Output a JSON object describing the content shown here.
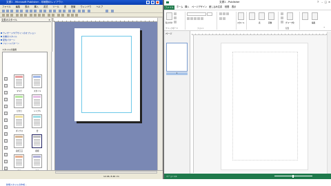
{
  "left_app": {
    "title": "文書1 - Microsoft Publisher - 印刷物のレイアウト",
    "menu": [
      "ファイル",
      "編集",
      "表示",
      "挿入",
      "書式",
      "ツール",
      "表",
      "配置",
      "ウィンドウ",
      "ヘルプ"
    ],
    "zoom_value": "39%",
    "taskpane": {
      "header": "文書のスタイル",
      "links": [
        "ウィザードやデザインのオプション",
        "文書のスタイル",
        "配色パターン",
        "フォントパターン"
      ],
      "apply_label": "スタイルの適用",
      "styles": [
        {
          "label": "マルチ",
          "color": "#e8a0a0"
        },
        {
          "label": "スタイル",
          "color": "#a0b8e8"
        },
        {
          "label": "ひかり",
          "color": "#b8e8a0"
        },
        {
          "label": "シンプル",
          "color": "#e8c0e8"
        },
        {
          "label": "ボックス",
          "color": "#f0e0a0"
        },
        {
          "label": "雲",
          "color": "#a0e0e8"
        },
        {
          "label": "自然工芸",
          "color": "#d8b898"
        },
        {
          "label": "模様",
          "color": "#c0c0c0"
        },
        {
          "label": "格子",
          "color": "#e8b090"
        },
        {
          "label": "直線",
          "color": "#b0b0d8"
        }
      ],
      "footer_link": "新規スタイルの作成..."
    },
    "status_coord": "12.46, 8.46 cm"
  },
  "right_app": {
    "title": "文書1 - Publisher",
    "file_tab": "ファイル",
    "tabs": [
      "ホーム",
      "挿入",
      "ページデザイン",
      "差し込み文書",
      "校閲",
      "表示"
    ],
    "ribbon": {
      "paste_label": "貼り付け",
      "clipboard_group": "クリップボード",
      "font_group": "フォント",
      "style_label": "スタイル",
      "picture_label": "画像",
      "table_label": "表",
      "group_label": "グループ化",
      "arrange_group": "配置",
      "edit_label": "編集"
    },
    "pages_label": "ページ",
    "thumb_number": "1",
    "status_left": "ページ: 1/1"
  }
}
